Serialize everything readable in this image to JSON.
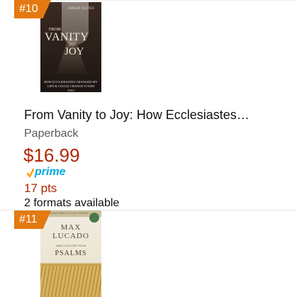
{
  "products": [
    {
      "rank": "#10",
      "cover": {
        "author": "JOHAN ESTES",
        "word_from": "FROM",
        "word_vanity": "VANITY",
        "word_to": "TO",
        "word_joy": "JOY",
        "subtitle": "HOW ECCLESIASTES CHANGED MY LIFE & COULD CHANGE YOURS TOO"
      },
      "title": "From Vanity to Joy: How Ecclesiastes…",
      "format": "Paperback",
      "price": "$16.99",
      "prime_label": "prime",
      "points": "17 pts",
      "formats_available": "2 formats available"
    },
    {
      "rank": "#11",
      "cover": {
        "series": "LIFEGUIDE BIBLE STUDY SERIES",
        "author_line1": "MAX",
        "author_line2": "LUCADO",
        "lessons": "NINE LESSONS FROM",
        "book": "PSALMS"
      }
    }
  ],
  "colors": {
    "badge": "#e47911",
    "price": "#b12704",
    "prime": "#00a8e1",
    "check": "#ff9900",
    "format_text": "#565959"
  }
}
